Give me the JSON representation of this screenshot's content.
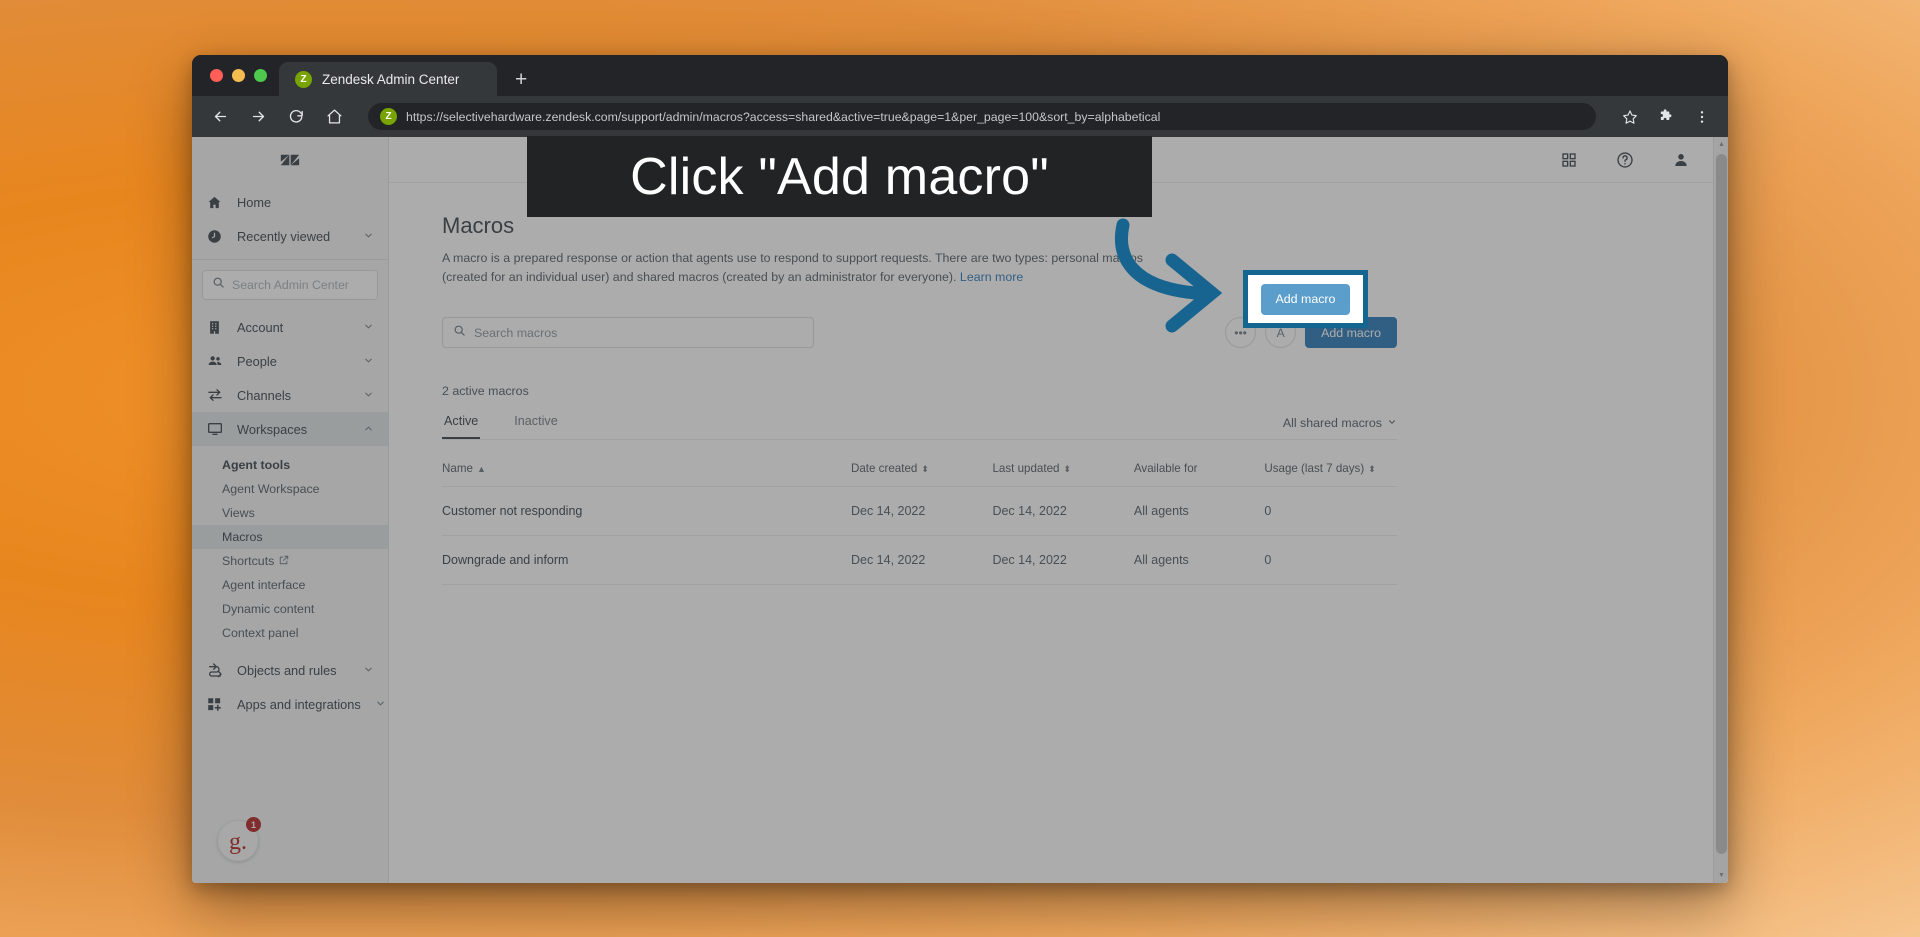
{
  "browser": {
    "tab_title": "Zendesk Admin Center",
    "favicon_letter": "Z",
    "new_tab_label": "+",
    "url": "https://selectivehardware.zendesk.com/support/admin/macros?access=shared&active=true&page=1&per_page=100&sort_by=alphabetical",
    "nav": {
      "back": "back-arrow",
      "forward": "forward-arrow",
      "reload": "reload",
      "home": "home"
    },
    "right_icons": {
      "bookmark": "star",
      "extensions": "puzzle-piece",
      "menu": "three-dot-vertical"
    }
  },
  "sidebar": {
    "logo": "zendesk-logo",
    "search_placeholder": "Search Admin Center",
    "search_value": "",
    "top_items": [
      {
        "label": "Home",
        "icon": "home-icon",
        "expandable": false
      },
      {
        "label": "Recently viewed",
        "icon": "clock-icon",
        "expandable": true
      }
    ],
    "items": [
      {
        "label": "Account",
        "icon": "building-icon",
        "expandable": true,
        "expanded": false
      },
      {
        "label": "People",
        "icon": "people-icon",
        "expandable": true,
        "expanded": false
      },
      {
        "label": "Channels",
        "icon": "channels-icon",
        "expandable": true,
        "expanded": false
      },
      {
        "label": "Workspaces",
        "icon": "monitor-icon",
        "expandable": true,
        "expanded": true
      }
    ],
    "workspaces_sub": {
      "heading": "Agent tools",
      "items": [
        {
          "label": "Agent Workspace",
          "external": false,
          "active": false
        },
        {
          "label": "Views",
          "external": false,
          "active": false
        },
        {
          "label": "Macros",
          "external": false,
          "active": true
        },
        {
          "label": "Shortcuts",
          "external": true,
          "active": false
        },
        {
          "label": "Agent interface",
          "external": false,
          "active": false
        },
        {
          "label": "Dynamic content",
          "external": false,
          "active": false
        },
        {
          "label": "Context panel",
          "external": false,
          "active": false
        }
      ]
    },
    "bottom_items": [
      {
        "label": "Objects and rules",
        "icon": "objects-rules-icon",
        "expandable": true
      },
      {
        "label": "Apps and integrations",
        "icon": "apps-grid-icon",
        "expandable": true
      }
    ],
    "widget": {
      "letter": "g.",
      "badge": "1",
      "name": "gorgias-widget"
    }
  },
  "topbar": {
    "icons": [
      {
        "name": "apps-grid-icon"
      },
      {
        "name": "help-question-icon"
      },
      {
        "name": "user-profile-icon"
      }
    ]
  },
  "main": {
    "title": "Macros",
    "description": "A macro is a prepared response or action that agents use to respond to support requests. There are two types: personal macros (created for an individual user) and shared macros (created by an administrator for everyone).",
    "learn_more": "Learn more",
    "search_placeholder": "Search macros",
    "search_value": "",
    "more_options_label": "•••",
    "apply_label": "A",
    "add_macro_label": "Add macro",
    "count_text": "2 active macros",
    "tabs": [
      {
        "label": "Active",
        "active": true
      },
      {
        "label": "Inactive",
        "active": false
      }
    ],
    "filter_label": "All shared macros",
    "table": {
      "columns": [
        {
          "label": "Name",
          "sort": "asc"
        },
        {
          "label": "Date created",
          "sort": "both"
        },
        {
          "label": "Last updated",
          "sort": "both"
        },
        {
          "label": "Available for",
          "sort": "none"
        },
        {
          "label": "Usage (last 7 days)",
          "sort": "both"
        }
      ],
      "rows": [
        {
          "name": "Customer not responding",
          "date_created": "Dec 14, 2022",
          "last_updated": "Dec 14, 2022",
          "available_for": "All agents",
          "usage": "0"
        },
        {
          "name": "Downgrade and inform",
          "date_created": "Dec 14, 2022",
          "last_updated": "Dec 14, 2022",
          "available_for": "All agents",
          "usage": "0"
        }
      ]
    }
  },
  "annotation": {
    "callout_text": "Click \"Add macro\"",
    "highlight_button_label": "Add macro",
    "arrow": "curved-arrow-pointing-right",
    "colors": {
      "accent_blue": "#1f73b7",
      "annotation_blue": "#14658f",
      "callout_bg": "#222324",
      "zendesk_green": "#78a300"
    }
  }
}
